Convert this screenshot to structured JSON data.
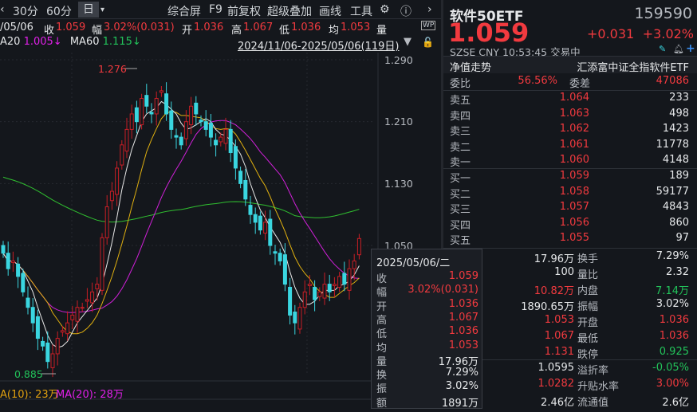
{
  "toolbar": {
    "tabs": [
      "30分",
      "60分",
      "日"
    ],
    "selected": "日",
    "actions": [
      "综合屏",
      "F9",
      "前复权",
      "超级叠加",
      "画线",
      "工具"
    ]
  },
  "info": {
    "date": "/05/06",
    "close_label": "收",
    "close": "1.059",
    "range_label": "幅",
    "range": "3.02%(0.031)",
    "open_label": "开",
    "open": "1.036",
    "high_label": "高",
    "high": "1.067",
    "low_label": "低",
    "low": "1.036",
    "avg_label": "均",
    "avg": "1.053",
    "vol_label": "量"
  },
  "ma": {
    "ma20_label": "A20",
    "ma20": "1.005↓",
    "ma60_label": "MA60",
    "ma60": "1.115↓",
    "range": "2024/11/06-2025/05/06(119日)"
  },
  "volume_ma": {
    "ma10": "A(10): 23万",
    "ma20": "MA(20): 28万"
  },
  "colors": {
    "up": "#c81e26",
    "down": "#3ad6e0",
    "ma5": "#e8e8e8",
    "ma10": "#e0b010",
    "ma20": "#d020d8",
    "ma60": "#30c030"
  },
  "chart_data": {
    "type": "candlestick",
    "price_axis": [
      "1.290",
      "1.210",
      "1.130",
      "1.050"
    ],
    "ylim": [
      0.86,
      1.3
    ],
    "max_label": "1.276",
    "min_label": "0.885",
    "closes": [
      1.04,
      1.02,
      1.03,
      1.01,
      0.99,
      0.97,
      0.95,
      0.93,
      0.92,
      0.9,
      0.91,
      0.93,
      0.94,
      0.95,
      0.96,
      0.97,
      0.97,
      0.98,
      0.99,
      1.0,
      1.06,
      1.1,
      1.12,
      1.15,
      1.18,
      1.2,
      1.22,
      1.21,
      1.24,
      1.23,
      1.22,
      1.24,
      1.25,
      1.22,
      1.2,
      1.19,
      1.18,
      1.21,
      1.23,
      1.22,
      1.21,
      1.2,
      1.19,
      1.18,
      1.19,
      1.2,
      1.17,
      1.15,
      1.13,
      1.11,
      1.09,
      1.08,
      1.07,
      1.08,
      1.05,
      1.04,
      1.03,
      1.0,
      0.96,
      0.95,
      0.97,
      0.99,
      1.0,
      0.98,
      0.99,
      1.0,
      0.99,
      1.0,
      1.01,
      1.0,
      1.02,
      1.03,
      1.059
    ]
  },
  "quote": {
    "name": "软件50ETF",
    "code": "159590",
    "price": "1.059",
    "change": "+0.031",
    "pct": "+3.02%",
    "meta": "SZSE  CNY  10:53:45  交易中",
    "nav_label": "净值走势",
    "fund_name": "汇添富中证全指软件ETF",
    "wb_label": "委比",
    "wb": "56.56%",
    "wc_label": "委差",
    "wc": "47086"
  },
  "asks": [
    {
      "label": "卖五",
      "price": "1.064",
      "vol": "233"
    },
    {
      "label": "卖四",
      "price": "1.063",
      "vol": "498"
    },
    {
      "label": "卖三",
      "price": "1.062",
      "vol": "1423"
    },
    {
      "label": "卖二",
      "price": "1.061",
      "vol": "11778"
    },
    {
      "label": "卖一",
      "price": "1.060",
      "vol": "4148"
    }
  ],
  "bids": [
    {
      "label": "买一",
      "price": "1.059",
      "vol": "189"
    },
    {
      "label": "买二",
      "price": "1.058",
      "vol": "59177"
    },
    {
      "label": "买三",
      "price": "1.057",
      "vol": "4843"
    },
    {
      "label": "买四",
      "price": "1.056",
      "vol": "860"
    },
    {
      "label": "买五",
      "price": "1.055",
      "vol": "97"
    }
  ],
  "stats": [
    {
      "v1": "17.96万",
      "l2": "换手",
      "v2": "7.29%",
      "c1": "white",
      "c2": "white"
    },
    {
      "v1": "100",
      "l2": "量比",
      "v2": "2.32",
      "c1": "white",
      "c2": "white"
    },
    {
      "v1": "10.82万",
      "l2": "内盘",
      "v2": "7.14万",
      "c1": "red",
      "c2": "green"
    },
    {
      "v1": "1890.65万",
      "l2": "振幅",
      "v2": "3.02%",
      "c1": "white",
      "c2": "white"
    },
    {
      "v1": "1.053",
      "l2": "开盘",
      "v2": "1.036",
      "c1": "red",
      "c2": "red"
    },
    {
      "v1": "1.067",
      "l2": "最低",
      "v2": "1.036",
      "c1": "red",
      "c2": "red"
    },
    {
      "v1": "1.131",
      "l2": "跌停",
      "v2": "0.925",
      "c1": "red",
      "c2": "green"
    },
    {
      "v1": "1.0595",
      "l2": "溢折率",
      "v2": "-0.05%",
      "c1": "white",
      "c2": "green"
    },
    {
      "v1": "1.0282",
      "l2": "升贴水率",
      "v2": "3.00%",
      "c1": "red",
      "c2": "red"
    },
    {
      "v1": "2.46亿",
      "l2": "流通值",
      "v2": "2.6亿",
      "c1": "white",
      "c2": "white"
    }
  ],
  "tooltip": {
    "date": "2025/05/06/二",
    "rows": [
      {
        "l": "收",
        "v": "1.059",
        "c": "red"
      },
      {
        "l": "幅",
        "v": "3.02%(0.031)",
        "c": "red"
      },
      {
        "l": "开",
        "v": "1.036",
        "c": "red"
      },
      {
        "l": "高",
        "v": "1.067",
        "c": "red"
      },
      {
        "l": "低",
        "v": "1.036",
        "c": "red"
      },
      {
        "l": "均",
        "v": "1.053",
        "c": "red"
      },
      {
        "l": "量",
        "v": "17.96万",
        "c": "white"
      },
      {
        "l": "换",
        "v": "7.29%",
        "c": "white"
      },
      {
        "l": "振",
        "v": "3.02%",
        "c": "white"
      },
      {
        "l": "额",
        "v": "1891万",
        "c": "white"
      }
    ]
  }
}
